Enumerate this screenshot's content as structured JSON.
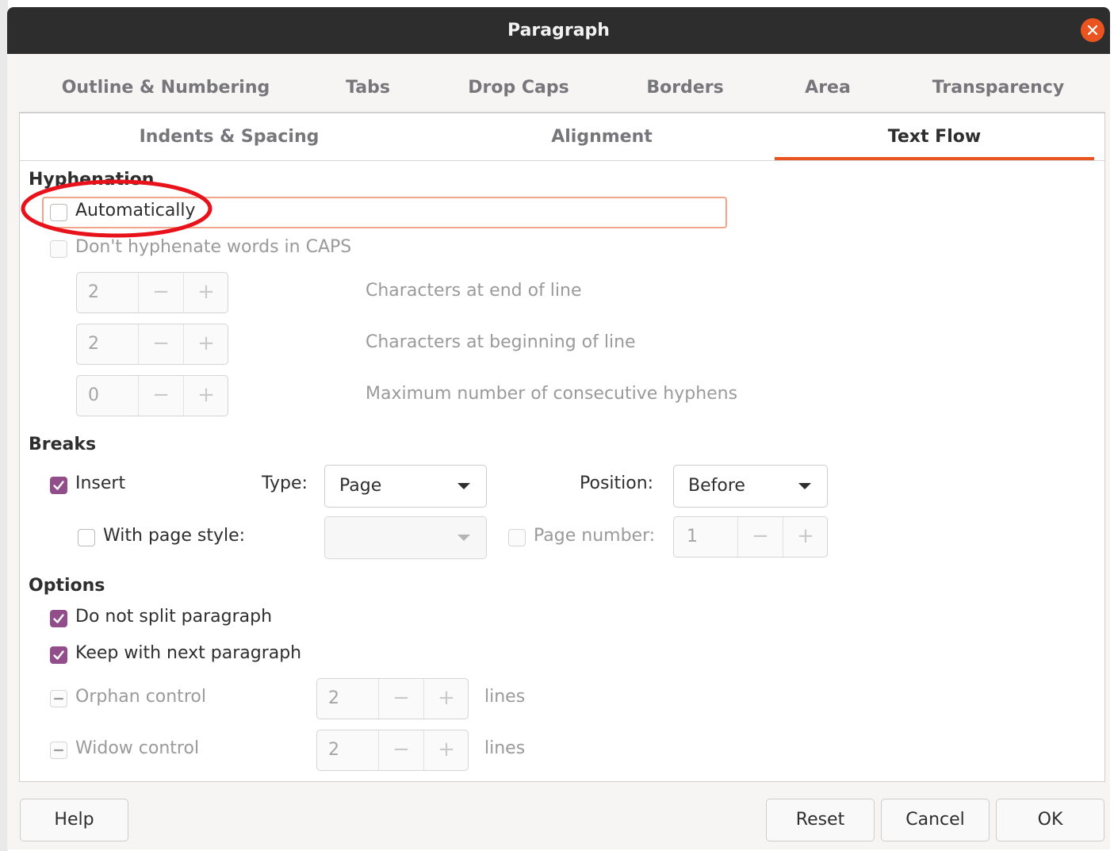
{
  "window": {
    "title": "Paragraph"
  },
  "tabs_row1": [
    "Outline & Numbering",
    "Tabs",
    "Drop Caps",
    "Borders",
    "Area",
    "Transparency"
  ],
  "tabs_row2": [
    "Indents & Spacing",
    "Alignment",
    "Text Flow"
  ],
  "active_tab": "Text Flow",
  "hyphenation": {
    "heading": "Hyphenation",
    "automatically": {
      "label": "Automatically",
      "checked": false
    },
    "dont_caps": {
      "label": "Don't hyphenate words in CAPS",
      "checked": false
    },
    "chars_end": {
      "value": "2",
      "label": "Characters at end of line"
    },
    "chars_begin": {
      "value": "2",
      "label": "Characters at beginning of line"
    },
    "max_hyphens": {
      "value": "0",
      "label": "Maximum number of consecutive hyphens"
    }
  },
  "breaks": {
    "heading": "Breaks",
    "insert": {
      "label": "Insert",
      "checked": true
    },
    "type_label": "Type:",
    "type_value": "Page",
    "position_label": "Position:",
    "position_value": "Before",
    "with_page_style": {
      "label": "With page style:",
      "checked": false
    },
    "page_style_value": "",
    "page_number": {
      "label": "Page number:",
      "checked": false,
      "value": "1"
    }
  },
  "options": {
    "heading": "Options",
    "do_not_split": {
      "label": "Do not split paragraph",
      "checked": true
    },
    "keep_with_next": {
      "label": "Keep with next paragraph",
      "checked": true
    },
    "orphan": {
      "label": "Orphan control",
      "value": "2",
      "unit": "lines",
      "state": "indeterminate"
    },
    "widow": {
      "label": "Widow control",
      "value": "2",
      "unit": "lines",
      "state": "indeterminate"
    }
  },
  "spin_symbols": {
    "minus": "−",
    "plus": "+"
  },
  "buttons": {
    "help": "Help",
    "reset": "Reset",
    "cancel": "Cancel",
    "ok": "OK"
  },
  "colors": {
    "accent": "#e95420",
    "checkbox_checked": "#924d8b",
    "titlebar": "#2d2d2d",
    "annotation": "#e8121b"
  }
}
